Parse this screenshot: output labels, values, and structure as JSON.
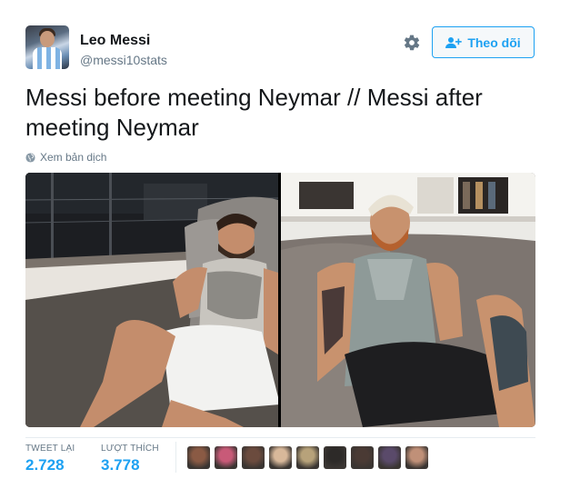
{
  "user": {
    "name": "Leo Messi",
    "handle": "@messi10stats"
  },
  "follow_button": {
    "label": "Theo dõi"
  },
  "tweet": {
    "text_line1": "Messi before meeting Neymar // Messi after",
    "text_line2": "meeting Neymar",
    "translate_label": "Xem bản dịch"
  },
  "stats": {
    "retweets_label": "TWEET LẠI",
    "retweets_value": "2.728",
    "likes_label": "LƯỢT THÍCH",
    "likes_value": "3.778"
  },
  "liker_avatars": [
    "#8a5a44",
    "#c85a78",
    "#6b4b3e",
    "#d8b89a",
    "#b7a27a",
    "#2d2a28",
    "#4a3a34",
    "#5a4a6a",
    "#c09078"
  ],
  "colors": {
    "accent": "#1da1f2",
    "secondary_text": "#657786",
    "primary_text": "#14171a"
  },
  "icons": {
    "settings": "gear-icon",
    "follow": "add-user-icon",
    "translate": "globe-icon"
  }
}
